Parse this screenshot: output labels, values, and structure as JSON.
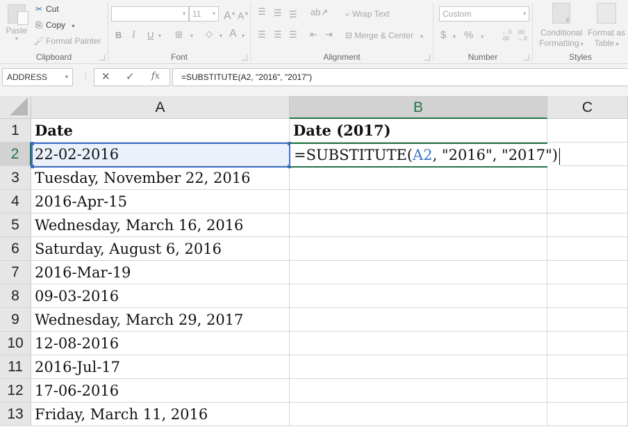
{
  "ribbon": {
    "clipboard": {
      "label": "Clipboard",
      "paste": "Paste",
      "cut": "Cut",
      "copy": "Copy",
      "format_painter": "Format Painter"
    },
    "font": {
      "label": "Font",
      "font_name": "",
      "font_size": "11",
      "bold": "B",
      "italic": "I",
      "underline": "U",
      "grow": "A",
      "shrink": "A",
      "font_color": "A"
    },
    "alignment": {
      "label": "Alignment",
      "wrap_text": "Wrap Text",
      "merge_center": "Merge & Center"
    },
    "number": {
      "label": "Number",
      "format": "Custom",
      "currency": "$",
      "percent": "%",
      "comma": ",",
      "inc_decimal": "←.0 .00",
      "dec_decimal": ".00 →.0"
    },
    "styles": {
      "label": "Styles",
      "conditional_formatting_1": "Conditional",
      "conditional_formatting_2": "Formatting",
      "format_as_table_1": "Format as",
      "format_as_table_2": "Table"
    }
  },
  "formula_bar": {
    "name_box": "ADDRESS",
    "cancel": "✕",
    "enter": "✓",
    "fx": "fx",
    "formula": "=SUBSTITUTE(A2, \"2016\", \"2017\")"
  },
  "grid": {
    "columns": [
      "A",
      "B",
      "C"
    ],
    "active_column": "B",
    "active_row": "2",
    "rows": [
      {
        "num": "1",
        "a": "Date",
        "b": "Date (2017)"
      },
      {
        "num": "2",
        "a": "22-02-2016",
        "b": ""
      },
      {
        "num": "3",
        "a": "Tuesday, November 22, 2016",
        "b": ""
      },
      {
        "num": "4",
        "a": "2016-Apr-15",
        "b": ""
      },
      {
        "num": "5",
        "a": "Wednesday, March 16, 2016",
        "b": ""
      },
      {
        "num": "6",
        "a": "Saturday, August 6, 2016",
        "b": ""
      },
      {
        "num": "7",
        "a": "2016-Mar-19",
        "b": ""
      },
      {
        "num": "8",
        "a": "09-03-2016",
        "b": ""
      },
      {
        "num": "9",
        "a": "Wednesday, March 29, 2017",
        "b": ""
      },
      {
        "num": "10",
        "a": "12-08-2016",
        "b": ""
      },
      {
        "num": "11",
        "a": "2016-Jul-17",
        "b": ""
      },
      {
        "num": "12",
        "a": "17-06-2016",
        "b": ""
      },
      {
        "num": "13",
        "a": "Friday, March 11, 2016",
        "b": ""
      }
    ],
    "editing_cell": {
      "prefix": "=SUBSTITUTE(",
      "ref": "A2",
      "suffix": ", \"2016\", \"2017\")"
    }
  },
  "colors": {
    "accent_green": "#217346",
    "selection_blue": "#3b6fc9",
    "ref_blue": "#3a75c4"
  }
}
